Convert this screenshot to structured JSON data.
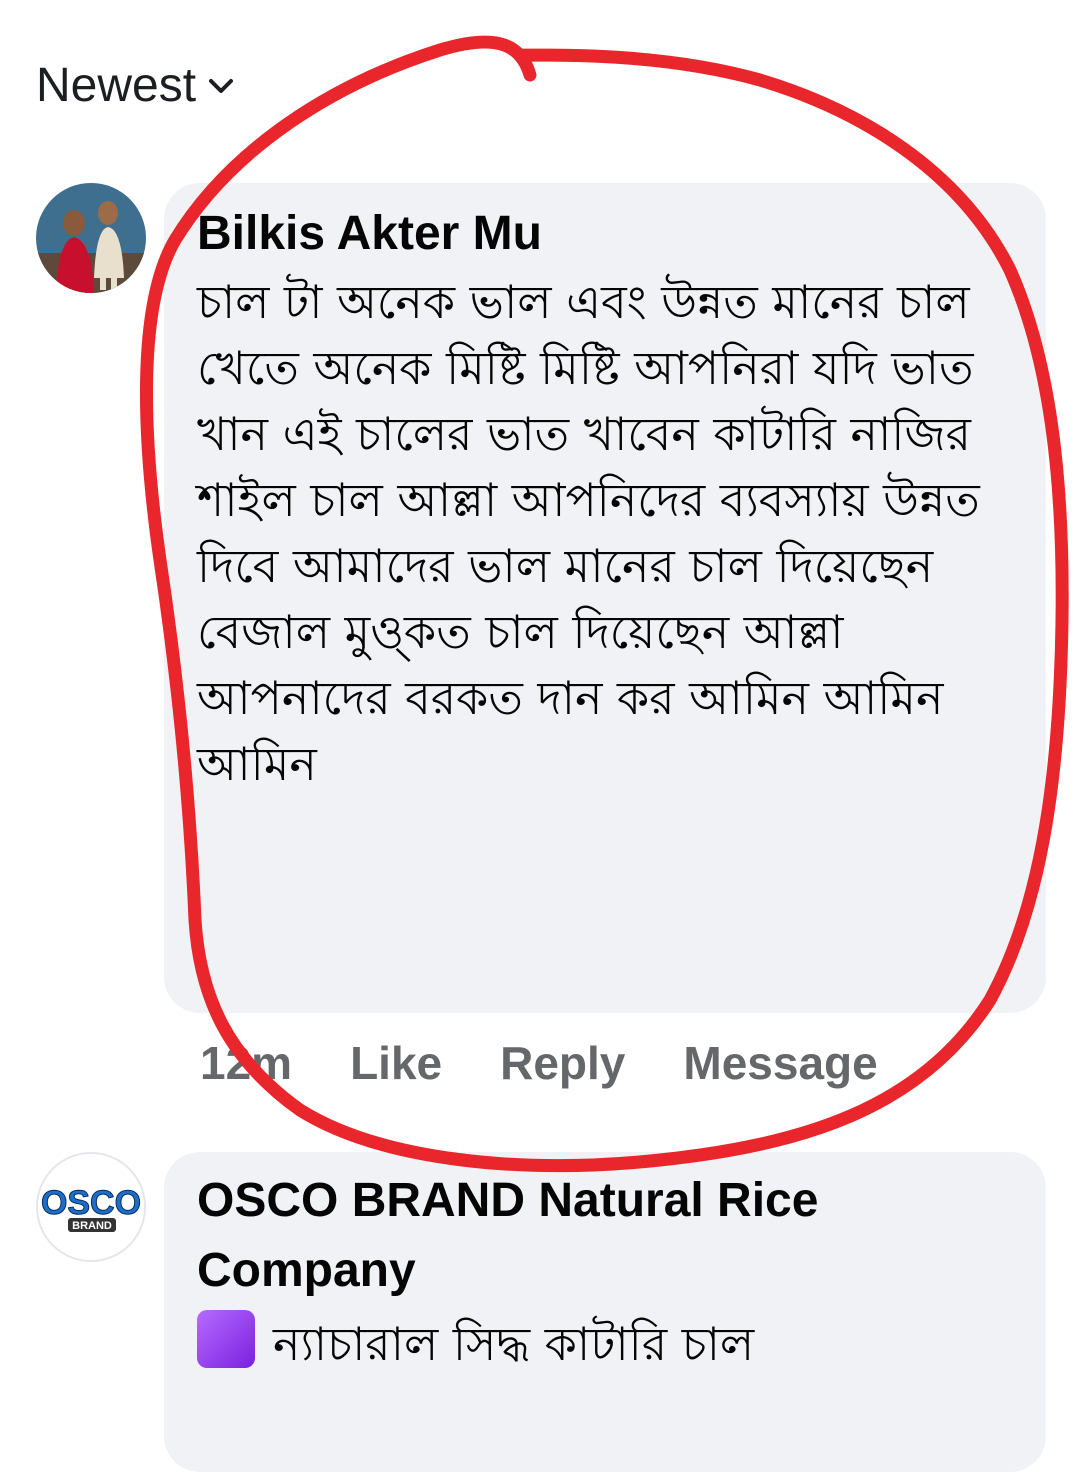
{
  "sort": {
    "label": "Newest"
  },
  "comments": [
    {
      "author": "Bilkis Akter Mu",
      "text": "চাল টা অনেক ভাল এবং উন্নত মানের চাল খেতে অনেক মিষ্টি মিষ্টি আপনিরা যদি ভাত খান এই চালের ভাত খাবেন কাটারি নাজির শাইল চাল আল্লা আপনিদের ব্যবস্যায় উন্নত দিবে আমাদের ভাল মানের চাল দিয়েছেন বেজাল মুও্কত চাল দিয়েছেন আল্লা আপনাদের বরকত দান কর আমিন আমিন আমিন",
      "time": "12m",
      "like": "Like",
      "reply": "Reply",
      "message": "Message"
    },
    {
      "author": "OSCO BRAND Natural Rice Company",
      "text": "ন্যাচারাল সিদ্ধ কাটারি চাল",
      "avatar_logo": "OSCO",
      "avatar_sub": "BRAND"
    }
  ],
  "colors": {
    "annotation": "#e8262b",
    "bubble": "#f0f2f5",
    "meta": "#65676b"
  }
}
